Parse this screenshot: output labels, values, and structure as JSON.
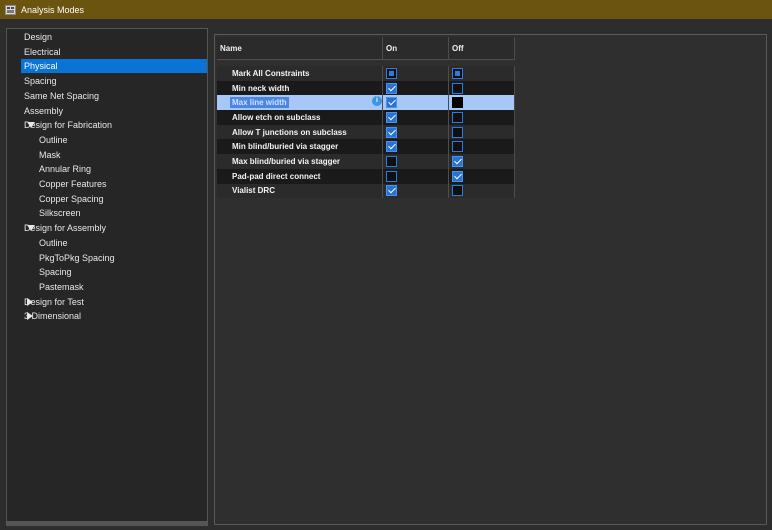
{
  "window": {
    "title": "Analysis Modes",
    "icon": "analysis-modes-app-icon"
  },
  "sidebar": {
    "items": [
      {
        "label": "Design",
        "level": 0,
        "expander": "none",
        "selected": false
      },
      {
        "label": "Electrical",
        "level": 0,
        "expander": "none",
        "selected": false
      },
      {
        "label": "Physical",
        "level": 0,
        "expander": "none",
        "selected": true
      },
      {
        "label": "Spacing",
        "level": 0,
        "expander": "none",
        "selected": false
      },
      {
        "label": "Same Net Spacing",
        "level": 0,
        "expander": "none",
        "selected": false
      },
      {
        "label": "Assembly",
        "level": 0,
        "expander": "none",
        "selected": false
      },
      {
        "label": "Design for Fabrication",
        "level": 0,
        "expander": "expanded",
        "selected": false
      },
      {
        "label": "Outline",
        "level": 1,
        "expander": "none",
        "selected": false
      },
      {
        "label": "Mask",
        "level": 1,
        "expander": "none",
        "selected": false
      },
      {
        "label": "Annular Ring",
        "level": 1,
        "expander": "none",
        "selected": false
      },
      {
        "label": "Copper Features",
        "level": 1,
        "expander": "none",
        "selected": false
      },
      {
        "label": "Copper Spacing",
        "level": 1,
        "expander": "none",
        "selected": false
      },
      {
        "label": "Silkscreen",
        "level": 1,
        "expander": "none",
        "selected": false
      },
      {
        "label": "Design for Assembly",
        "level": 0,
        "expander": "expanded",
        "selected": false
      },
      {
        "label": "Outline",
        "level": 1,
        "expander": "none",
        "selected": false
      },
      {
        "label": "PkgToPkg Spacing",
        "level": 1,
        "expander": "none",
        "selected": false
      },
      {
        "label": "Spacing",
        "level": 1,
        "expander": "none",
        "selected": false
      },
      {
        "label": "Pastemask",
        "level": 1,
        "expander": "none",
        "selected": false
      },
      {
        "label": "Design for Test",
        "level": 0,
        "expander": "collapsed",
        "selected": false
      },
      {
        "label": "3 Dimensional",
        "level": 0,
        "expander": "collapsed",
        "selected": false
      }
    ]
  },
  "grid": {
    "columns": {
      "name": "Name",
      "on": "On",
      "off": "Off"
    },
    "rows": [
      {
        "name": "Mark All Constraints",
        "on": "partial",
        "off": "partial",
        "highlighted": false
      },
      {
        "name": "Min neck width",
        "on": "checked",
        "off": "unchecked",
        "highlighted": false
      },
      {
        "name": "Max line width",
        "on": "checked",
        "off": "unchecked",
        "highlighted": true
      },
      {
        "name": "Allow etch on subclass",
        "on": "checked",
        "off": "unchecked",
        "highlighted": false
      },
      {
        "name": "Allow T junctions on subclass",
        "on": "checked",
        "off": "unchecked",
        "highlighted": false
      },
      {
        "name": "Min blind/buried via stagger",
        "on": "checked",
        "off": "unchecked",
        "highlighted": false
      },
      {
        "name": "Max blind/buried via stagger",
        "on": "unchecked",
        "off": "checked",
        "highlighted": false
      },
      {
        "name": "Pad-pad direct connect",
        "on": "unchecked",
        "off": "checked",
        "highlighted": false
      },
      {
        "name": "Vialist DRC",
        "on": "checked",
        "off": "unchecked",
        "highlighted": false
      }
    ]
  },
  "colors": {
    "title_bar": "#6b5310",
    "selection": "#0a74d6",
    "checkbox_accent": "#2872d4",
    "row_highlight": "#a7c7f7"
  }
}
